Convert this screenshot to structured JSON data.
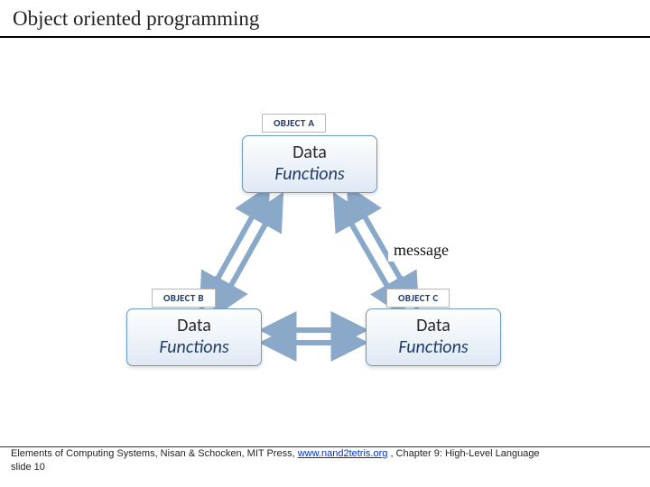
{
  "title": "Object oriented programming",
  "diagram": {
    "object_a": {
      "label": "OBJECT A",
      "data": "Data",
      "functions": "Functions"
    },
    "object_b": {
      "label": "OBJECT B",
      "data": "Data",
      "functions": "Functions"
    },
    "object_c": {
      "label": "OBJECT C",
      "data": "Data",
      "functions": "Functions"
    },
    "message_label": "message"
  },
  "footer": {
    "prefix": "Elements of Computing Systems, Nisan & Schocken, MIT Press, ",
    "link_text": "www.nand2tetris.org",
    "suffix": " , Chapter 9: High-Level Language",
    "slide": "slide 10"
  }
}
